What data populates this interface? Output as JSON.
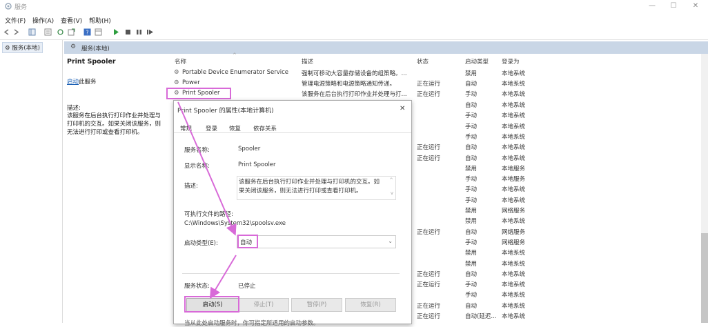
{
  "window": {
    "title": "服务",
    "minimize": "—",
    "maximize": "☐",
    "close": "✕"
  },
  "menu": [
    {
      "label": "文件(F)"
    },
    {
      "label": "操作(A)"
    },
    {
      "label": "查看(V)"
    },
    {
      "label": "帮助(H)"
    }
  ],
  "tree": {
    "root_label": "服务(本地)"
  },
  "pane_header": "服务(本地)",
  "left_panel": {
    "service_name": "Print Spooler",
    "start_link": "启动",
    "start_link_suffix": "此服务",
    "desc_label": "描述:",
    "desc_lines": [
      "该服务在后台执行打印作业并处理与",
      "打印机的交互。如果关闭该服务，则",
      "无法进行打印或查看打印机。"
    ]
  },
  "columns": {
    "name": "名称",
    "desc": "描述",
    "status": "状态",
    "startup": "启动类型",
    "logon": "登录为"
  },
  "visible_rows": [
    {
      "name": "Portable Device Enumerator Service",
      "desc": "强制可移动大容量存储设备的组策略。...",
      "status": "",
      "startup": "禁用",
      "logon": "本地系统"
    },
    {
      "name": "Power",
      "desc": "管理电源策略和电源策略通知传递。",
      "status": "正在运行",
      "startup": "自动",
      "logon": "本地系统"
    },
    {
      "name": "Print Spooler",
      "desc": "该服务在后台执行打印作业并处理与打...",
      "status": "正在运行",
      "startup": "手动",
      "logon": "本地系统"
    }
  ],
  "extra_rows": [
    {
      "status": "",
      "startup": "自动",
      "logon": "本地系统"
    },
    {
      "status": "",
      "startup": "手动",
      "logon": "本地系统"
    },
    {
      "status": "",
      "startup": "手动",
      "logon": "本地系统"
    },
    {
      "status": "",
      "startup": "手动",
      "logon": "本地系统"
    },
    {
      "status": "正在运行",
      "startup": "自动",
      "logon": "本地系统"
    },
    {
      "status": "正在运行",
      "startup": "自动",
      "logon": "本地系统"
    },
    {
      "status": "",
      "startup": "禁用",
      "logon": "本地服务"
    },
    {
      "status": "",
      "startup": "手动",
      "logon": "本地服务"
    },
    {
      "status": "",
      "startup": "手动",
      "logon": "本地系统"
    },
    {
      "status": "",
      "startup": "手动",
      "logon": "本地系统"
    },
    {
      "status": "",
      "startup": "禁用",
      "logon": "网络服务"
    },
    {
      "status": "",
      "startup": "禁用",
      "logon": "本地系统"
    },
    {
      "status": "正在运行",
      "startup": "自动",
      "logon": "网络服务"
    },
    {
      "status": "",
      "startup": "手动",
      "logon": "网络服务"
    },
    {
      "status": "",
      "startup": "禁用",
      "logon": "本地系统"
    },
    {
      "status": "",
      "startup": "禁用",
      "logon": "本地系统"
    },
    {
      "status": "正在运行",
      "startup": "自动",
      "logon": "本地系统"
    },
    {
      "status": "正在运行",
      "startup": "手动",
      "logon": "本地系统"
    },
    {
      "status": "",
      "startup": "手动",
      "logon": "本地系统"
    },
    {
      "status": "正在运行",
      "startup": "自动",
      "logon": "本地系统"
    },
    {
      "status": "正在运行",
      "startup": "自动(延迟...",
      "logon": "本地系统"
    }
  ],
  "dialog": {
    "title": "Print Spooler 的属性(本地计算机)",
    "close": "✕",
    "tabs": [
      {
        "label": "常规"
      },
      {
        "label": "登录"
      },
      {
        "label": "恢复"
      },
      {
        "label": "依存关系"
      }
    ],
    "service_name_label": "服务名称:",
    "service_name_value": "Spooler",
    "display_name_label": "显示名称:",
    "display_name_value": "Print Spooler",
    "desc_label": "描述:",
    "desc_lines": [
      "该服务在后台执行打印作业并处理与打印机的交互。如",
      "果关闭该服务，则无法进行打印或查看打印机。"
    ],
    "exe_label": "可执行文件的路径:",
    "exe_path": "C:\\Windows\\System32\\spoolsv.exe",
    "startup_label": "启动类型(E):",
    "startup_value": "自动",
    "status_label": "服务状态:",
    "status_value": "已停止",
    "buttons": {
      "start": "启动(S)",
      "stop": "停止(T)",
      "pause": "暂停(P)",
      "resume": "恢复(R)"
    },
    "footer_partial": "当从此处启动服务时，你可指定所适用的启动参数。"
  },
  "colors": {
    "highlight": "#d86ad8",
    "header_bar": "#c9d6e6",
    "link": "#1a5fb4",
    "toolbar_green": "#2e9e3f"
  },
  "icons": [
    "window-app-icon",
    "back-arrow-icon",
    "forward-arrow-icon",
    "show-tree-icon",
    "properties-icon",
    "refresh-icon",
    "export-icon",
    "help-icon",
    "view-icon",
    "play-icon",
    "stop-icon",
    "pause-icon",
    "restart-icon",
    "service-gear-icon"
  ]
}
